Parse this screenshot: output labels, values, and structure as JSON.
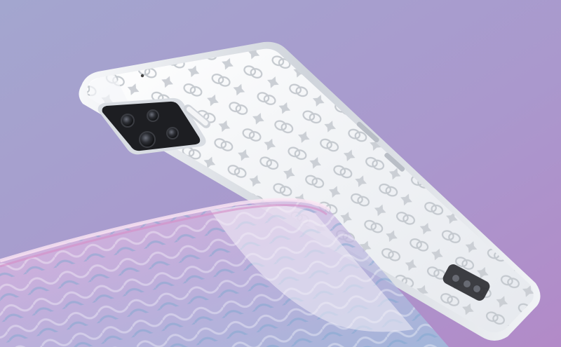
{
  "scene": {
    "subject": "smartphone-back",
    "colors": {
      "bg_top": "#a6a8d0",
      "bg_bottom": "#b08cc9",
      "phone_body": "#f3f5f8",
      "phone_edge": "#d9dde3",
      "pattern": "#c9cdd2",
      "camera_module": "#1f2024",
      "glass_pink": "#e7a8d6",
      "glass_blue": "#8fb4d6"
    },
    "icons": [
      "camera-lens-icon",
      "flash-icon",
      "logo-pattern-icon"
    ]
  }
}
